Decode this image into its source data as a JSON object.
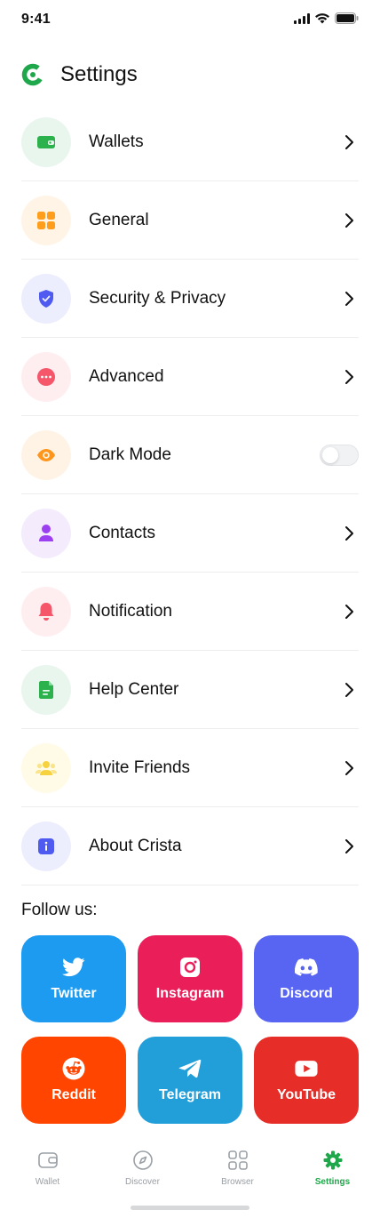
{
  "status": {
    "time": "9:41"
  },
  "header": {
    "title": "Settings"
  },
  "settings": {
    "items": [
      {
        "label": "Wallets",
        "icon": "wallet-icon",
        "bg": "#e9f6ee",
        "color": "#2bb24c"
      },
      {
        "label": "General",
        "icon": "grid-icon",
        "bg": "#fff4e6",
        "color": "#ff9d1c"
      },
      {
        "label": "Security & Privacy",
        "icon": "shield-icon",
        "bg": "#eceefe",
        "color": "#4f5bf0"
      },
      {
        "label": "Advanced",
        "icon": "more-icon",
        "bg": "#ffeef0",
        "color": "#f5566a"
      },
      {
        "label": "Dark Mode",
        "icon": "eye-icon",
        "bg": "#fff3e6",
        "color": "#ff961c",
        "toggle": false
      },
      {
        "label": "Contacts",
        "icon": "user-icon",
        "bg": "#f4ebfd",
        "color": "#9b3ff0"
      },
      {
        "label": "Notification",
        "icon": "bell-icon",
        "bg": "#ffeef0",
        "color": "#f5566a"
      },
      {
        "label": "Help Center",
        "icon": "document-icon",
        "bg": "#e9f6ee",
        "color": "#2bb24c"
      },
      {
        "label": "Invite Friends",
        "icon": "users-icon",
        "bg": "#fffbe6",
        "color": "#f7d240"
      },
      {
        "label": "About Crista",
        "icon": "info-icon",
        "bg": "#eceefe",
        "color": "#4f5bf0"
      }
    ]
  },
  "follow": {
    "title": "Follow us:",
    "socials": [
      {
        "label": "Twitter",
        "icon": "twitter-icon",
        "color": "#1d9bf0"
      },
      {
        "label": "Instagram",
        "icon": "instagram-icon",
        "color": "#ea1f5a"
      },
      {
        "label": "Discord",
        "icon": "discord-icon",
        "color": "#5865f2"
      },
      {
        "label": "Reddit",
        "icon": "reddit-icon",
        "color": "#ff4500"
      },
      {
        "label": "Telegram",
        "icon": "telegram-icon",
        "color": "#229ed9"
      },
      {
        "label": "YouTube",
        "icon": "youtube-icon",
        "color": "#e62d27"
      }
    ]
  },
  "nav": {
    "items": [
      {
        "label": "Wallet",
        "icon": "wallet-outline-icon",
        "active": false
      },
      {
        "label": "Discover",
        "icon": "compass-icon",
        "active": false
      },
      {
        "label": "Browser",
        "icon": "apps-icon",
        "active": false
      },
      {
        "label": "Settings",
        "icon": "gear-icon",
        "active": true
      }
    ],
    "active_color": "#1fa84b",
    "inactive_color": "#9aa0a6"
  }
}
